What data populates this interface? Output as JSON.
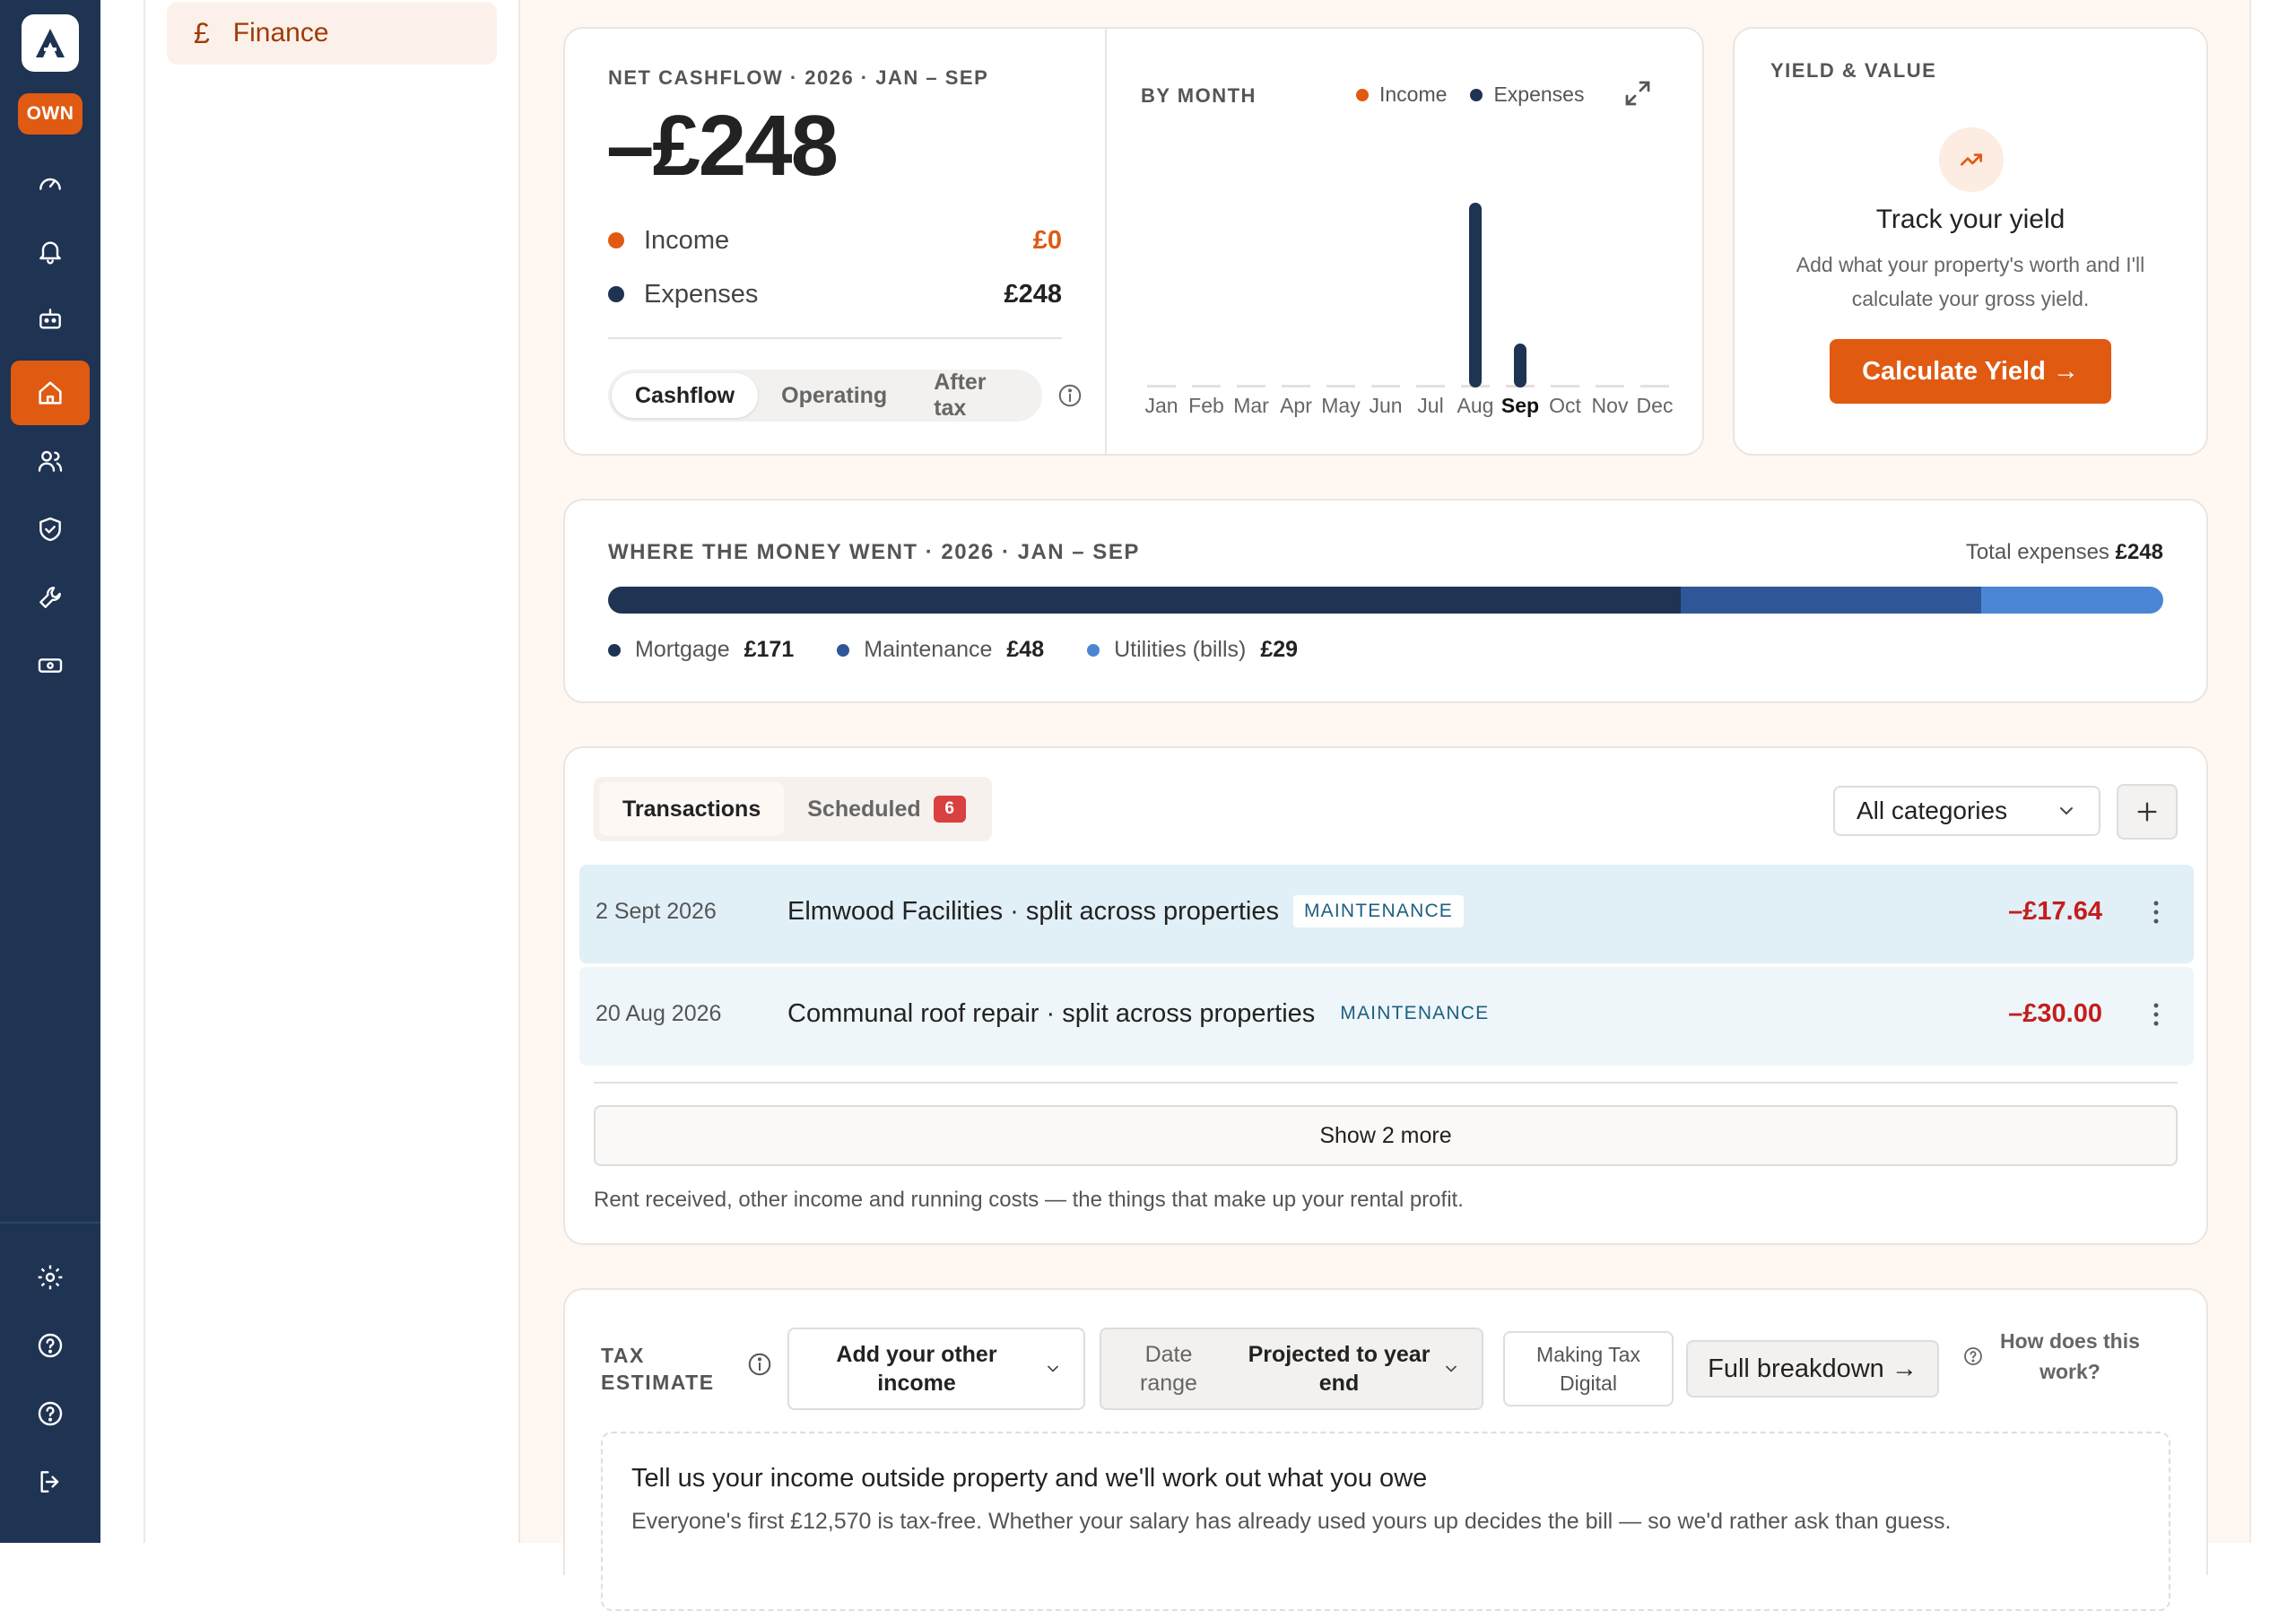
{
  "rail": {
    "own_badge": "OWN",
    "icons": [
      "dashboard-icon",
      "bell-icon",
      "robot-icon",
      "home-icon",
      "people-icon",
      "shield-icon",
      "wrench-icon",
      "cash-icon",
      "gear-icon",
      "help-icon",
      "help-circle-icon",
      "logout-icon"
    ]
  },
  "sidebar": {
    "finance_label": "Finance"
  },
  "cashflow": {
    "title": "NET CASHFLOW · 2026 · JAN – SEP",
    "value": "–£248",
    "income_label": "Income",
    "income_value": "£0",
    "expenses_label": "Expenses",
    "expenses_value": "£248",
    "tabs": [
      "Cashflow",
      "Operating",
      "After tax"
    ]
  },
  "by_month": {
    "title": "BY MONTH",
    "legend_income": "Income",
    "legend_expenses": "Expenses"
  },
  "chart_data": {
    "type": "bar",
    "categories": [
      "Jan",
      "Feb",
      "Mar",
      "Apr",
      "May",
      "Jun",
      "Jul",
      "Aug",
      "Sep",
      "Oct",
      "Nov",
      "Dec"
    ],
    "highlight": "Sep",
    "series": [
      {
        "name": "Income",
        "values": [
          0,
          0,
          0,
          0,
          0,
          0,
          0,
          0,
          0,
          0,
          0,
          0
        ]
      },
      {
        "name": "Expenses",
        "values": [
          0,
          0,
          0,
          0,
          0,
          0,
          0,
          200.36,
          47.64,
          0,
          0,
          0
        ]
      }
    ],
    "colors": {
      "income": "#e05a12",
      "expenses": "#1f3353"
    }
  },
  "yield": {
    "title": "YIELD & VALUE",
    "heading": "Track your yield",
    "line1": "Add what your property's worth and I'll",
    "line2": "calculate your gross yield.",
    "button": "Calculate Yield →"
  },
  "money": {
    "title": "WHERE THE MONEY WENT · 2026 · JAN – SEP",
    "total_label": "Total expenses",
    "total_value": "£248",
    "segments": [
      {
        "name": "Mortgage",
        "value": "£171",
        "amount": 171,
        "color": "#1f3353"
      },
      {
        "name": "Maintenance",
        "value": "£48",
        "amount": 48,
        "color": "#2f5797"
      },
      {
        "name": "Utilities (bills)",
        "value": "£29",
        "amount": 29,
        "color": "#4a86d4"
      }
    ]
  },
  "transactions": {
    "tab_transactions": "Transactions",
    "tab_scheduled": "Scheduled",
    "scheduled_count": "6",
    "filter": "All categories",
    "rows": [
      {
        "date": "2 Sept 2026",
        "desc": "Elmwood Facilities · split across properties",
        "tag": "MAINTENANCE",
        "amount": "–£17.64"
      },
      {
        "date": "20 Aug 2026",
        "desc": "Communal roof repair · split across properties",
        "tag": "MAINTENANCE",
        "amount": "–£30.00"
      }
    ],
    "show_more": "Show 2 more",
    "footnote": "Rent received, other income and running costs — the things that make up your rental profit."
  },
  "tax": {
    "label_line1": "TAX",
    "label_line2": "ESTIMATE",
    "other_income_line1": "Add your other",
    "other_income_line2": "income",
    "date_range_line1": "Date",
    "date_range_line2": "range",
    "projected_line1": "Projected to year",
    "projected_line2": "end",
    "mtd_line1": "Making Tax",
    "mtd_line2": "Digital",
    "full_breakdown": "Full breakdown →",
    "how_line1": "How does this",
    "how_line2": "work?",
    "heading": "Tell us your income outside property and we'll work out what you owe",
    "body": "Everyone's first £12,570 is tax-free. Whether your salary has already used yours up decides the bill — so we'd rather ask than guess."
  }
}
